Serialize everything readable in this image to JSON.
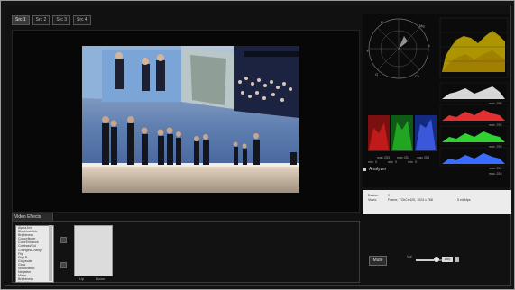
{
  "tabs": [
    "Src 1",
    "Src 2",
    "Src 3",
    "Src 4"
  ],
  "analyzer_label": "Analyzer",
  "scope": {
    "vectorscope_labels": [
      "R",
      "Mg",
      "B",
      "Cy",
      "G",
      "Yl"
    ],
    "stats": {
      "min": [
        "min",
        "0",
        "min",
        "0",
        "min",
        "0"
      ],
      "max": [
        "max",
        "253",
        "max",
        "251",
        "max",
        "253"
      ]
    },
    "histogram_max": [
      "max: 255",
      "max: 252",
      "max: 253",
      "max: 251",
      "max: 253"
    ]
  },
  "info": {
    "device_label": "Device:",
    "device_value": "0",
    "video_label": "Video:",
    "video_value": "Frame, YCbCr 420, 1024 x 768",
    "rate_value": "5 ed/kfps"
  },
  "video_effects": {
    "title": "Video Effects",
    "list": [
      "AlphaJoin",
      "BlockInvisible",
      "Brightness",
      "Colourfinder",
      "ColorEnhance",
      "Contrast/Col",
      "ChangeBChangr",
      "Flip",
      "FlipLR",
      "Grayscale",
      "Glow",
      "NoiseBlend",
      "Negative",
      "Mirror",
      "Brightness",
      "NightVision"
    ],
    "up_label": "Up",
    "down_label": "Down"
  },
  "audio": {
    "mute_label": "Mute",
    "volume_label": "Vol",
    "volume_value": "100",
    "volume_level": 0.67
  },
  "colors": {
    "accent": "#cfcfcf",
    "panel_bg": "#111111"
  }
}
